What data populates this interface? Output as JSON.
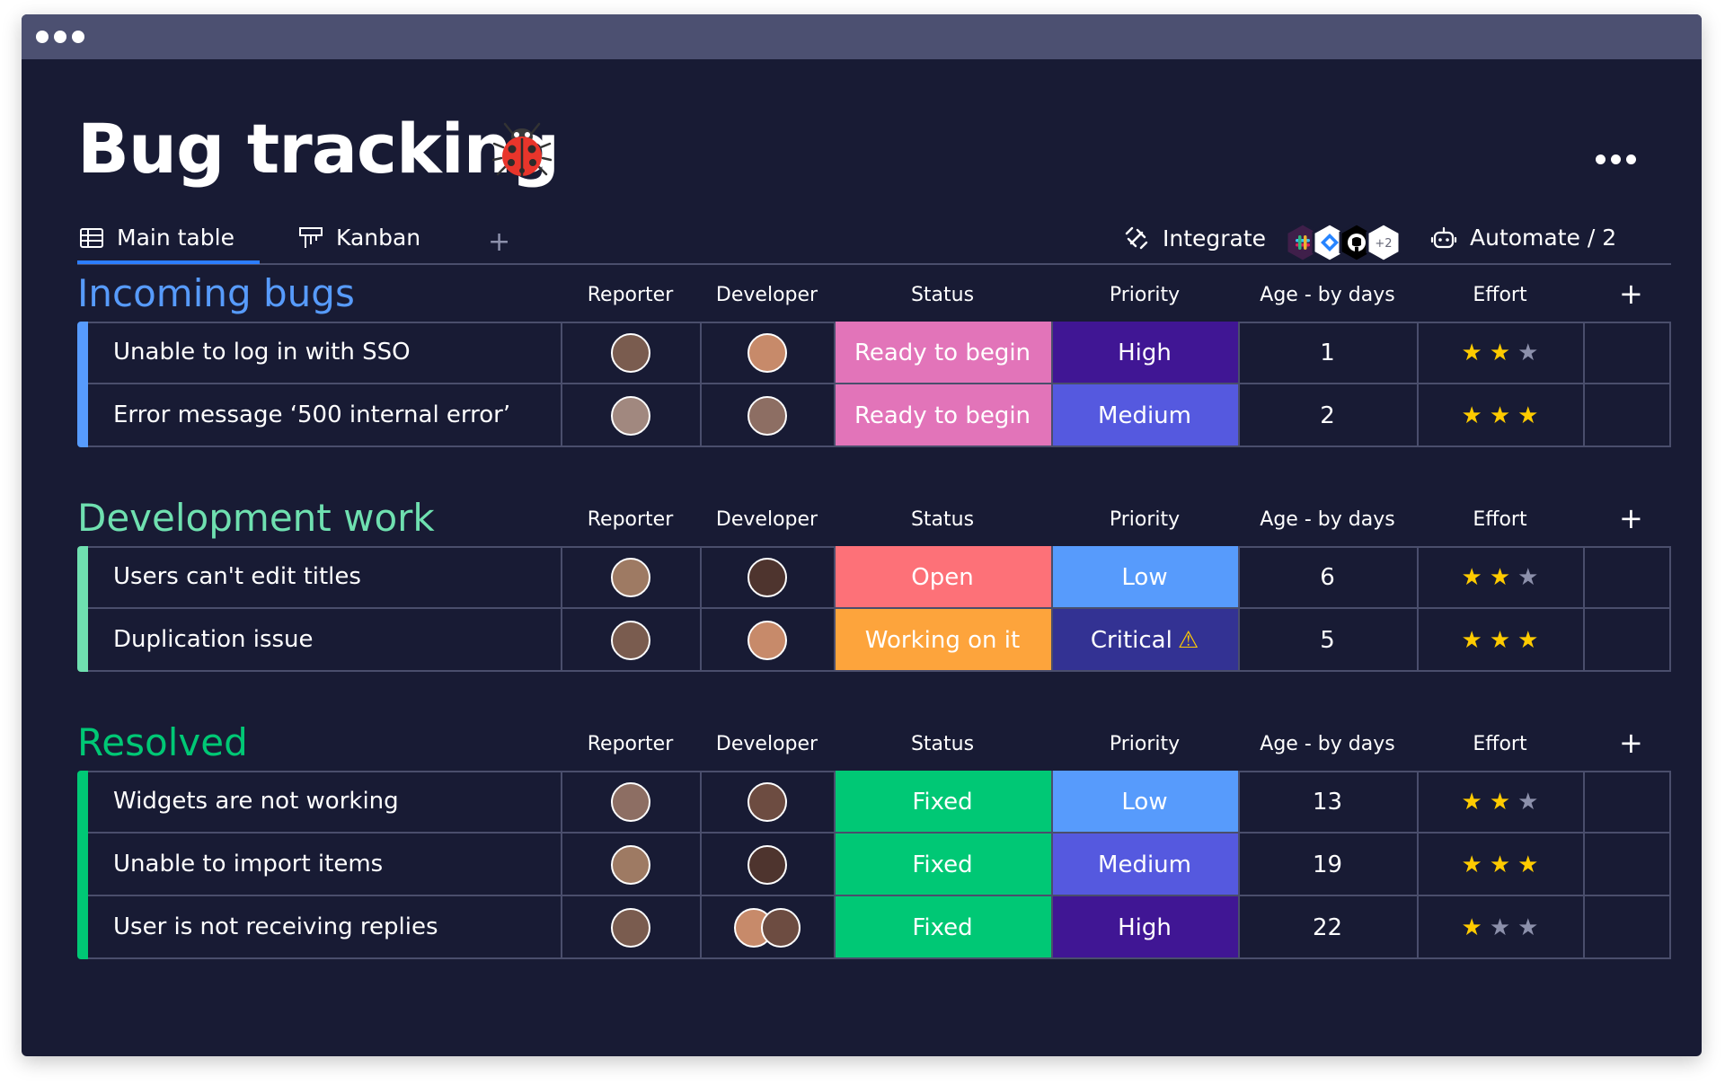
{
  "board": {
    "title": "Bug tracking",
    "tabs": [
      {
        "label": "Main table",
        "icon": "table-grid-icon"
      },
      {
        "label": "Kanban",
        "icon": "kanban-icon"
      }
    ],
    "add_view": "+",
    "integrate_label": "Integrate",
    "integration_extra_count": "+2",
    "automate_label": "Automate / 2"
  },
  "columns": [
    "Reporter",
    "Developer",
    "Status",
    "Priority",
    "Age - by days",
    "Effort"
  ],
  "add_column": "+",
  "colors": {
    "background": "#181b34",
    "ready_to_begin": "#e274b9",
    "open": "#fd7178",
    "working_on_it": "#fda43c",
    "fixed": "#00c875",
    "priority_high": "#401694",
    "priority_medium": "#5559df",
    "priority_low": "#579bfc",
    "priority_critical": "#333293",
    "star_on": "#ffcb00",
    "star_off": "#8c90ab"
  },
  "groups": [
    {
      "title": "Incoming bugs",
      "color": "#579bfc",
      "rows": [
        {
          "name": "Unable to log in with SSO",
          "reporter": "R1",
          "developer": "D1",
          "status": "Ready to begin",
          "status_color": "#e274b9",
          "priority": "High",
          "priority_color": "#401694",
          "age": "1",
          "effort": 2
        },
        {
          "name": "Error message ‘500 internal error’",
          "reporter": "R2",
          "developer": "D2",
          "status": "Ready to begin",
          "status_color": "#e274b9",
          "priority": "Medium",
          "priority_color": "#5559df",
          "age": "2",
          "effort": 3
        }
      ]
    },
    {
      "title": "Development work",
      "color": "#6fe0b0",
      "rows": [
        {
          "name": "Users can't edit titles",
          "reporter": "R3",
          "developer": "D3",
          "status": "Open",
          "status_color": "#fd7178",
          "priority": "Low",
          "priority_color": "#579bfc",
          "age": "6",
          "effort": 2
        },
        {
          "name": "Duplication issue",
          "reporter": "R4",
          "developer": "D4",
          "status": "Working on it",
          "status_color": "#fda43c",
          "priority": "Critical",
          "priority_color": "#333293",
          "priority_warning": "⚠",
          "age": "5",
          "effort": 3
        }
      ]
    },
    {
      "title": "Resolved",
      "color": "#00c875",
      "rows": [
        {
          "name": "Widgets are not working",
          "reporter": "R5",
          "developer": "D5",
          "status": "Fixed",
          "status_color": "#00c875",
          "priority": "Low",
          "priority_color": "#579bfc",
          "age": "13",
          "effort": 2
        },
        {
          "name": "Unable to import items",
          "reporter": "R6",
          "developer": "D6",
          "status": "Fixed",
          "status_color": "#00c875",
          "priority": "Medium",
          "priority_color": "#5559df",
          "age": "19",
          "effort": 3
        },
        {
          "name": "User is not receiving replies",
          "reporter": "R7",
          "developer": "D7",
          "status": "Fixed",
          "status_color": "#00c875",
          "priority": "High",
          "priority_color": "#401694",
          "age": "22",
          "effort": 1
        }
      ]
    }
  ]
}
